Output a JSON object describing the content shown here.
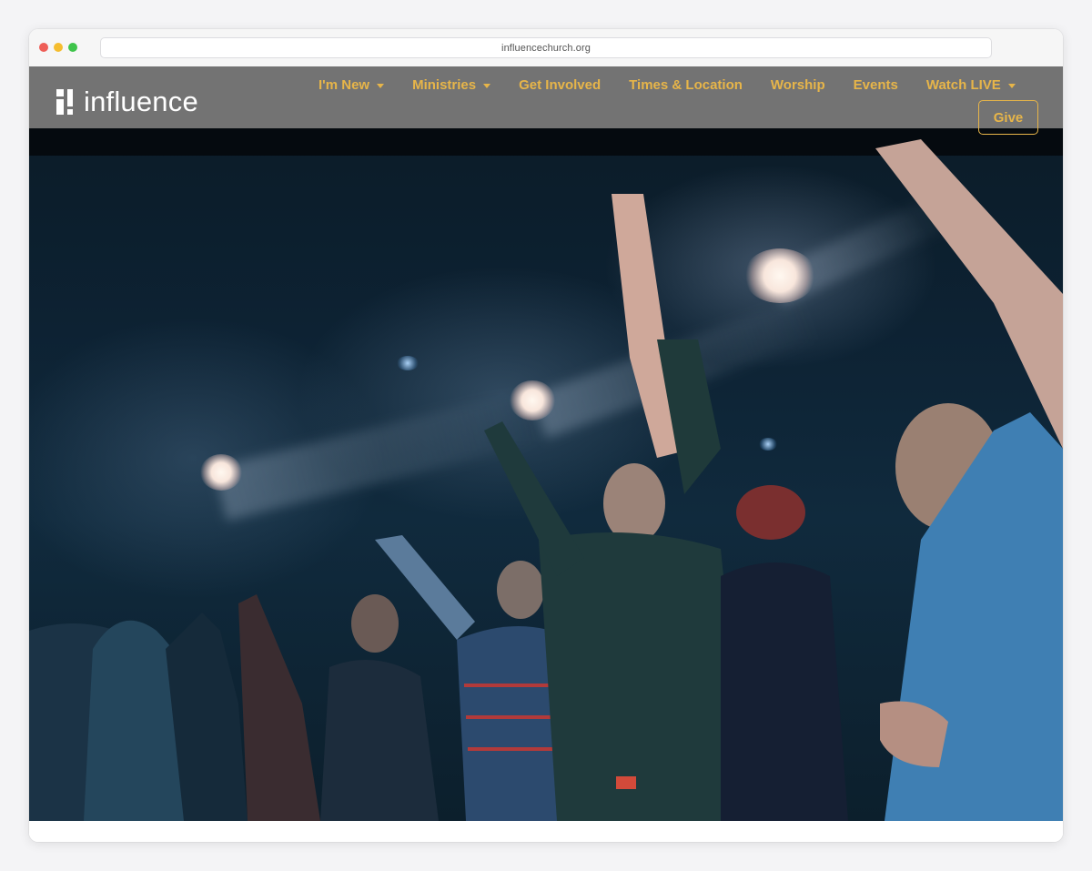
{
  "browser": {
    "url": "influencechurch.org"
  },
  "header": {
    "logo_text": "influence",
    "nav": [
      {
        "label": "I'm New",
        "has_dropdown": true
      },
      {
        "label": "Ministries",
        "has_dropdown": true
      },
      {
        "label": "Get Involved",
        "has_dropdown": false
      },
      {
        "label": "Times & Location",
        "has_dropdown": false
      },
      {
        "label": "Worship",
        "has_dropdown": false
      },
      {
        "label": "Events",
        "has_dropdown": false
      },
      {
        "label": "Watch LIVE",
        "has_dropdown": true
      }
    ],
    "give_label": "Give"
  },
  "colors": {
    "nav_text": "#e7b549",
    "header_bg": "#787878",
    "logo": "#ffffff"
  },
  "icons": {
    "logo": "influence-logo-icon",
    "dropdown": "caret-down-icon"
  }
}
